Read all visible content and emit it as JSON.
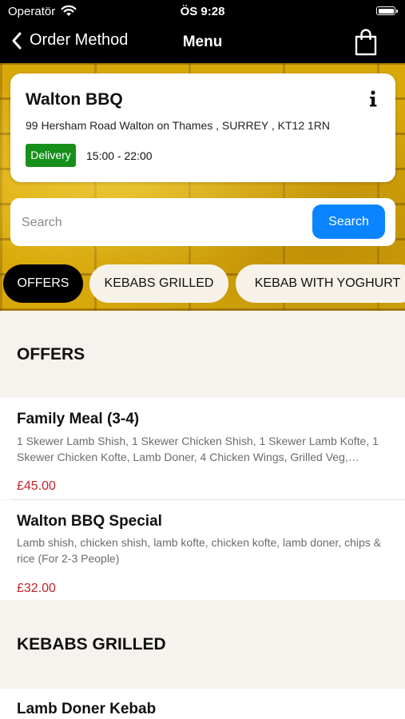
{
  "status_bar": {
    "carrier": "Operatör",
    "time": "ÖS 9:28"
  },
  "nav": {
    "back_label": "Order Method",
    "title": "Menu"
  },
  "restaurant": {
    "name": "Walton BBQ",
    "address": "99 Hersham Road Walton on Thames ,  SURREY , KT12 1RN",
    "service_badge": "Delivery",
    "hours": "15:00 - 22:00"
  },
  "search": {
    "placeholder": "Search",
    "button_label": "Search"
  },
  "categories": [
    "OFFERS",
    "KEBABS GRILLED",
    "KEBAB WITH YOGHURT"
  ],
  "sections": [
    {
      "title": "OFFERS",
      "items": [
        {
          "name": "Family Meal (3-4)",
          "description": "1 Skewer Lamb Shish, 1 Skewer Chicken Shish, 1 Skewer Lamb Kofte, 1 Skewer Chicken Kofte, Lamb Doner, 4 Chicken Wings, Grilled Veg,…",
          "price": "£45.00"
        },
        {
          "name": "Walton BBQ Special",
          "description": "Lamb shish, chicken shish, lamb kofte, chicken kofte, lamb doner, chips & rice (For 2-3 People)",
          "price": "£32.00"
        }
      ]
    },
    {
      "title": "KEBABS GRILLED",
      "items": [
        {
          "name": "Lamb Doner Kebab"
        }
      ]
    }
  ],
  "colors": {
    "accent_blue": "#0a84ff",
    "badge_green": "#17901a",
    "price_red": "#c0242a",
    "hero_yellow": "#d9a90a"
  }
}
